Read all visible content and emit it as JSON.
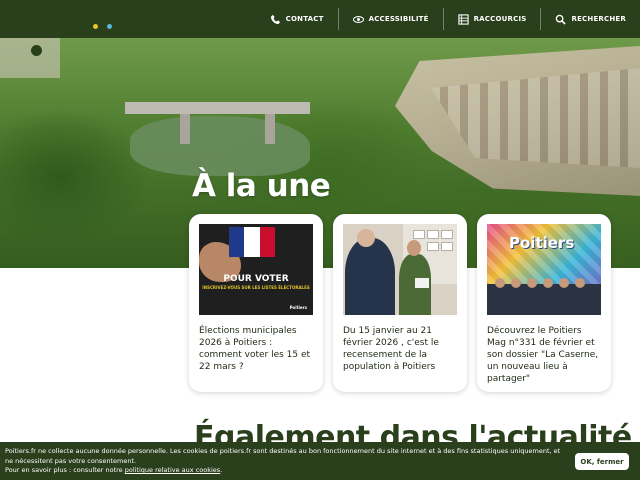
{
  "header": {
    "nav": [
      {
        "label": "CONTACT",
        "icon": "phone-icon"
      },
      {
        "label": "ACCESSIBILITÉ",
        "icon": "eye-icon"
      },
      {
        "label": "RACCOURCIS",
        "icon": "grid-icon"
      },
      {
        "label": "RECHERCHER",
        "icon": "search-icon"
      }
    ]
  },
  "hero": {
    "title": "À la une"
  },
  "cards": [
    {
      "text": "Élections municipales 2026 à Poitiers : comment voter les 15 et 22 mars ?",
      "image": {
        "title": "POUR VOTER",
        "subtitle": "INSCRIVEZ-VOUS SUR LES LISTES ÉLECTORALES",
        "logo": "Poitiers"
      }
    },
    {
      "text": "Du 15 janvier au 21 février 2026 , c'est le recensement de la population à Poitiers"
    },
    {
      "text": "Découvrez le Poitiers Mag n°331 de février et son dossier \"La Caserne, un nouveau lieu à partager\"",
      "image": {
        "word": "Poitiers"
      }
    }
  ],
  "section2": {
    "title": "Également dans l'actualité"
  },
  "cookie": {
    "text": "Poitiers.fr ne collecte aucune donnée personnelle. Les cookies de poitiers.fr sont destinés au bon fonctionnement du site internet et à des fins statistiques uniquement, et ne nécessitent pas votre consentement.",
    "more_prefix": "Pour en savoir plus : consulter notre ",
    "more_link": "politique relative aux cookies",
    "more_suffix": ".",
    "button": "OK, fermer"
  },
  "colors": {
    "brand": "#2a3f1c",
    "accent_yellow": "#e6c629",
    "accent_blue": "#5ab6d8"
  }
}
